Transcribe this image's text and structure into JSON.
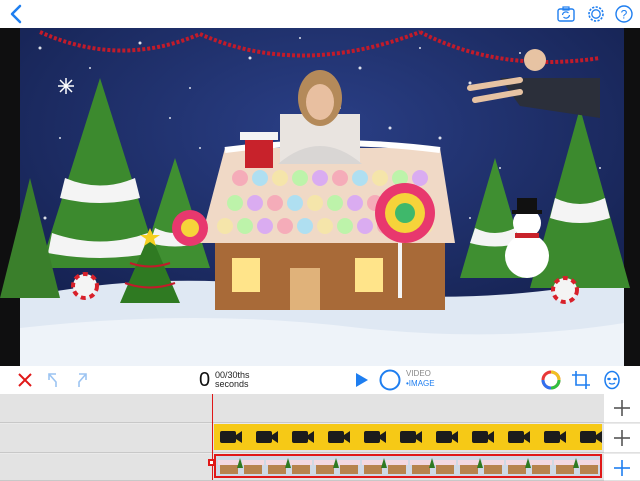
{
  "topbar": {
    "back_icon": "chevron-left-icon",
    "camera_icon": "camera-rotate-icon",
    "settings_icon": "gear-icon",
    "help_icon": "help-icon"
  },
  "toolbar": {
    "time_seconds": "0",
    "time_frames": "00/30ths",
    "time_unit": "seconds",
    "mode_video": "VIDEO",
    "mode_image": "•IMAGE",
    "icons": [
      "close-icon",
      "undo-icon",
      "redo-icon",
      "play-icon",
      "record-icon",
      "color-wheel-icon",
      "crop-icon",
      "mask-icon"
    ]
  },
  "colors": {
    "accent": "#1e7ef0",
    "danger": "#e01818",
    "clip_video": "#f6c916"
  },
  "timeline": {
    "tracks": [
      "empty",
      "video",
      "image"
    ],
    "add_buttons": [
      "+",
      "+",
      "+"
    ]
  }
}
